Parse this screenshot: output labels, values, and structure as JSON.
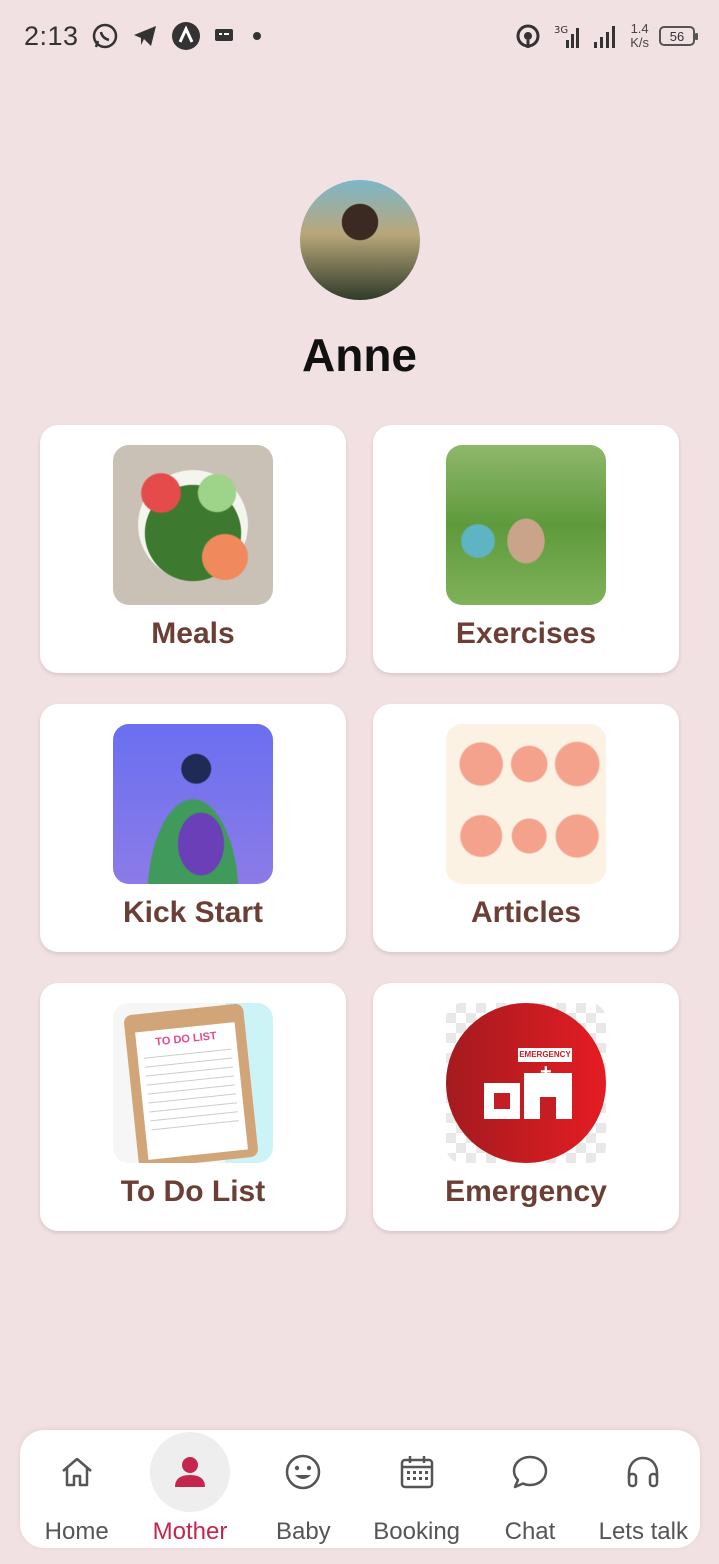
{
  "status_bar": {
    "time": "2:13",
    "net_speed_value": "1.4",
    "net_speed_unit": "K/s",
    "battery": "56",
    "network_type": "3G"
  },
  "profile": {
    "name": "Anne"
  },
  "cards": [
    {
      "label": "Meals"
    },
    {
      "label": "Exercises"
    },
    {
      "label": "Kick Start"
    },
    {
      "label": "Articles"
    },
    {
      "label": "To Do List"
    },
    {
      "label": "Emergency"
    }
  ],
  "todo_image_title": "TO DO LIST",
  "emergency_sign": "EMERGENCY",
  "bottom_nav": {
    "items": [
      {
        "label": "Home",
        "icon": "home-icon"
      },
      {
        "label": "Mother",
        "icon": "person-icon",
        "active": true
      },
      {
        "label": "Baby",
        "icon": "smiley-icon"
      },
      {
        "label": "Booking",
        "icon": "calendar-icon"
      },
      {
        "label": "Chat",
        "icon": "chat-bubble-icon"
      },
      {
        "label": "Lets talk",
        "icon": "headphones-icon"
      }
    ]
  },
  "colors": {
    "background": "#f2e1e3",
    "card_label": "#6b3f35",
    "active_nav": "#c4264e"
  }
}
